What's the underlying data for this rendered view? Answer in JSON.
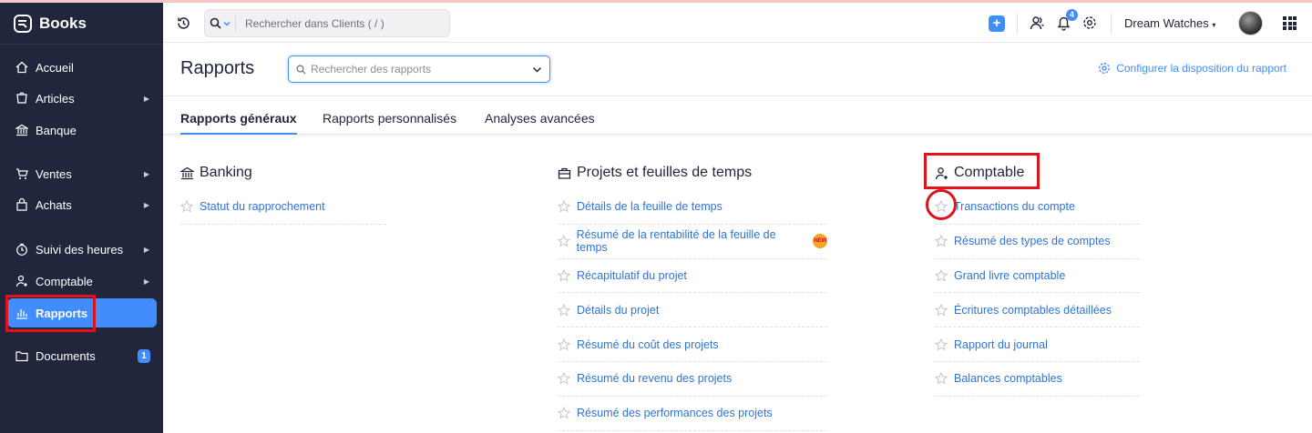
{
  "app": {
    "name": "Books"
  },
  "sidebar": {
    "items": [
      {
        "label": "Accueil",
        "icon": "home-icon",
        "arrow": false
      },
      {
        "label": "Articles",
        "icon": "tag-icon",
        "arrow": true
      },
      {
        "label": "Banque",
        "icon": "bank-icon",
        "arrow": false
      },
      {
        "label": "Ventes",
        "icon": "cart-icon",
        "arrow": true
      },
      {
        "label": "Achats",
        "icon": "bag-icon",
        "arrow": true
      },
      {
        "label": "Suivi des heures",
        "icon": "clock-icon",
        "arrow": true
      },
      {
        "label": "Comptable",
        "icon": "accountant-icon",
        "arrow": true
      },
      {
        "label": "Rapports",
        "icon": "chart-icon",
        "arrow": false,
        "active": true
      },
      {
        "label": "Documents",
        "icon": "folder-icon",
        "badge": "1"
      }
    ]
  },
  "header": {
    "search_placeholder": "Rechercher dans Clients ( / )",
    "notification_count": "4",
    "org_name": "Dream Watches"
  },
  "page": {
    "title": "Rapports",
    "search_placeholder": "Rechercher des rapports",
    "config_label": "Configurer la disposition du rapport"
  },
  "tabs": [
    {
      "label": "Rapports généraux",
      "active": true
    },
    {
      "label": "Rapports personnalisés"
    },
    {
      "label": "Analyses avancées"
    }
  ],
  "sections": {
    "banking": {
      "title": "Banking",
      "items": [
        "Statut du rapprochement"
      ]
    },
    "projects": {
      "title": "Projets et feuilles de temps",
      "items": [
        "Détails de la feuille de temps",
        "Résumé de la rentabilité de la feuille de temps",
        "Récapitulatif du projet",
        "Détails du projet",
        "Résumé du coût des projets",
        "Résumé du revenu des projets",
        "Résumé des performances des projets"
      ],
      "new_tag": "NEW"
    },
    "accountant": {
      "title": "Comptable",
      "items": [
        "Transactions du compte",
        "Résumé des types de comptes",
        "Grand livre comptable",
        "Écritures comptables détaillées",
        "Rapport du journal",
        "Balances comptables"
      ]
    }
  },
  "colors": {
    "sidebar_bg": "#21263c",
    "accent": "#408dfb",
    "highlight": "#e0121b",
    "link": "#2f74d6"
  }
}
